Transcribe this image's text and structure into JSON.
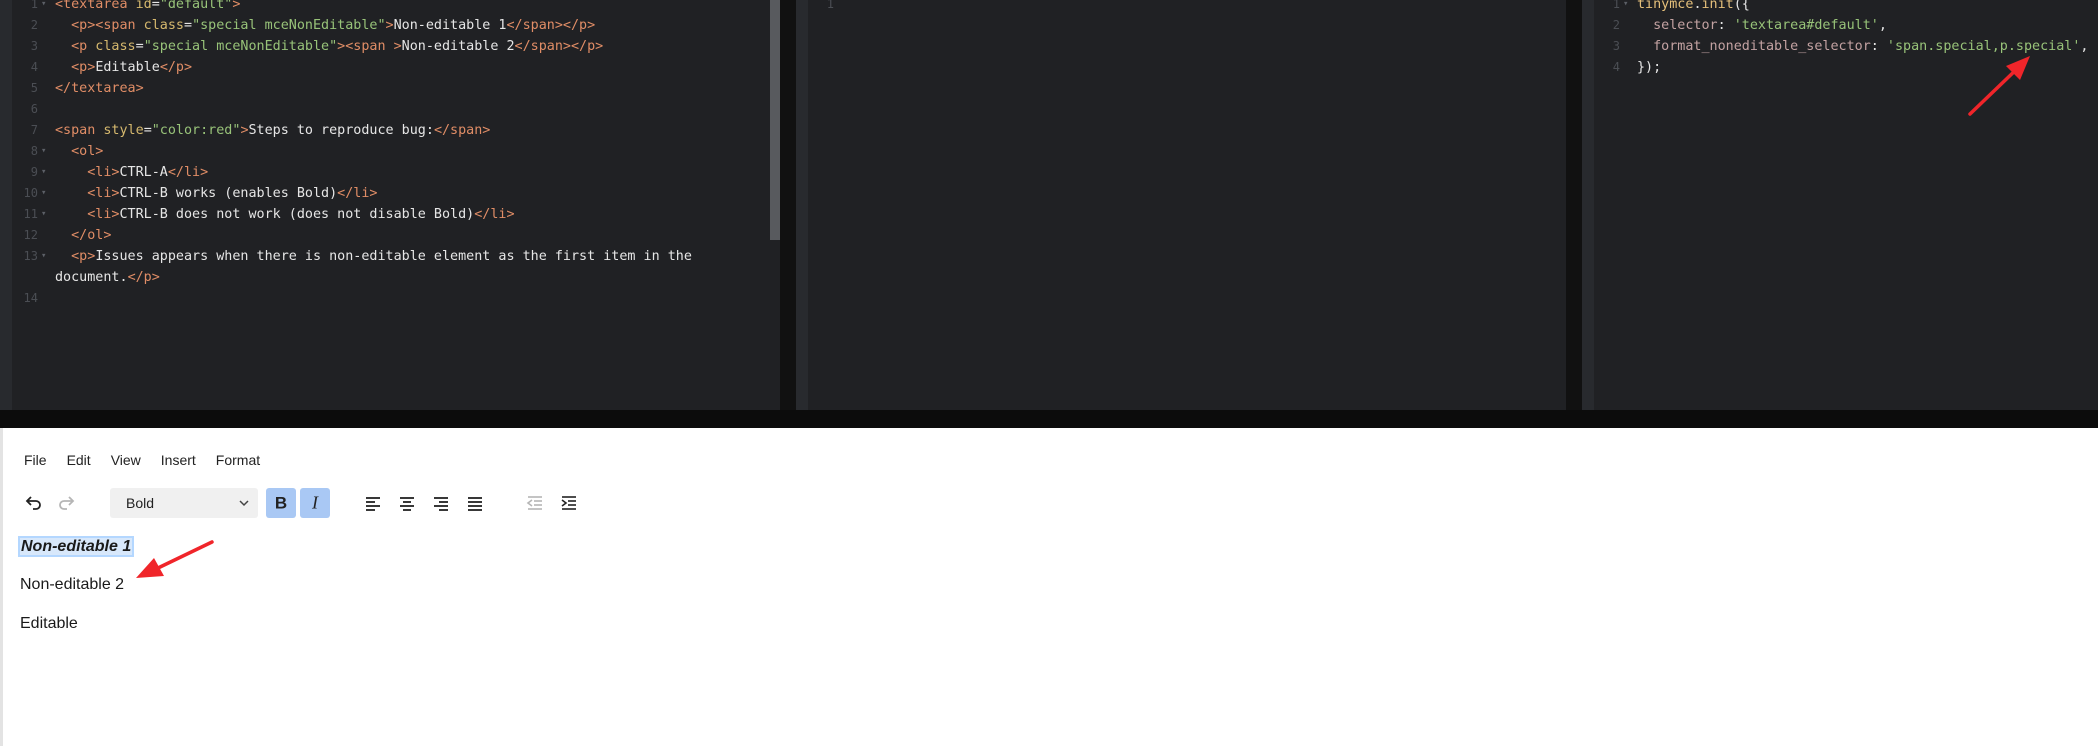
{
  "html_pane": {
    "lines": [
      {
        "n": "1",
        "fold": true,
        "segs": [
          [
            "t",
            "<textarea"
          ],
          [
            "a",
            " id"
          ],
          [
            "p",
            "="
          ],
          [
            "s",
            "\"default\""
          ],
          [
            "t",
            ">"
          ]
        ]
      },
      {
        "n": "2",
        "fold": false,
        "segs": [
          [
            "p",
            "  "
          ],
          [
            "t",
            "<p><span"
          ],
          [
            "a",
            " class"
          ],
          [
            "p",
            "="
          ],
          [
            "s",
            "\"special mceNonEditable\""
          ],
          [
            "t",
            ">"
          ],
          [
            "k",
            "Non-editable 1"
          ],
          [
            "t",
            "</span></p>"
          ]
        ]
      },
      {
        "n": "3",
        "fold": false,
        "segs": [
          [
            "p",
            "  "
          ],
          [
            "t",
            "<p"
          ],
          [
            "a",
            " class"
          ],
          [
            "p",
            "="
          ],
          [
            "s",
            "\"special mceNonEditable\""
          ],
          [
            "t",
            "><span >"
          ],
          [
            "k",
            "Non-editable 2"
          ],
          [
            "t",
            "</span></p>"
          ]
        ]
      },
      {
        "n": "4",
        "fold": false,
        "segs": [
          [
            "p",
            "  "
          ],
          [
            "t",
            "<p>"
          ],
          [
            "k",
            "Editable"
          ],
          [
            "t",
            "</p>"
          ]
        ]
      },
      {
        "n": "5",
        "fold": false,
        "segs": [
          [
            "t",
            "</textarea>"
          ]
        ]
      },
      {
        "n": "6",
        "fold": false,
        "segs": []
      },
      {
        "n": "7",
        "fold": false,
        "segs": [
          [
            "t",
            "<span"
          ],
          [
            "a",
            " style"
          ],
          [
            "p",
            "="
          ],
          [
            "s",
            "\"color:red\""
          ],
          [
            "t",
            ">"
          ],
          [
            "k",
            "Steps to reproduce bug:"
          ],
          [
            "t",
            "</span>"
          ]
        ]
      },
      {
        "n": "8",
        "fold": true,
        "segs": [
          [
            "p",
            "  "
          ],
          [
            "t",
            "<ol>"
          ]
        ]
      },
      {
        "n": "9",
        "fold": true,
        "segs": [
          [
            "p",
            "    "
          ],
          [
            "t",
            "<li>"
          ],
          [
            "k",
            "CTRL-A"
          ],
          [
            "t",
            "</li>"
          ]
        ]
      },
      {
        "n": "10",
        "fold": true,
        "segs": [
          [
            "p",
            "    "
          ],
          [
            "t",
            "<li>"
          ],
          [
            "k",
            "CTRL-B works (enables Bold)"
          ],
          [
            "t",
            "</li>"
          ]
        ]
      },
      {
        "n": "11",
        "fold": true,
        "segs": [
          [
            "p",
            "    "
          ],
          [
            "t",
            "<li>"
          ],
          [
            "k",
            "CTRL-B does not work (does not disable Bold)"
          ],
          [
            "t",
            "</li>"
          ]
        ]
      },
      {
        "n": "12",
        "fold": false,
        "segs": [
          [
            "p",
            "  "
          ],
          [
            "t",
            "</ol>"
          ]
        ]
      },
      {
        "n": "13",
        "fold": true,
        "segs": [
          [
            "p",
            "  "
          ],
          [
            "t",
            "<p>"
          ],
          [
            "k",
            "Issues appears when there is non-editable element as the first item in the"
          ]
        ]
      },
      {
        "n": "",
        "fold": false,
        "segs": [
          [
            "k",
            "document."
          ],
          [
            "t",
            "</p>"
          ]
        ]
      },
      {
        "n": "14",
        "fold": false,
        "segs": []
      }
    ]
  },
  "css_pane": {
    "lines": [
      {
        "n": "1",
        "fold": false,
        "segs": []
      }
    ]
  },
  "js_pane": {
    "lines": [
      {
        "n": "1",
        "fold": true,
        "segs": [
          [
            "f",
            "tinymce"
          ],
          [
            "p",
            "."
          ],
          [
            "f",
            "init"
          ],
          [
            "p",
            "({"
          ]
        ]
      },
      {
        "n": "2",
        "fold": false,
        "segs": [
          [
            "p",
            "  "
          ],
          [
            "pr",
            "selector"
          ],
          [
            "p",
            ": "
          ],
          [
            "s",
            "'textarea#default'"
          ],
          [
            "p",
            ","
          ]
        ]
      },
      {
        "n": "3",
        "fold": false,
        "segs": [
          [
            "p",
            "  "
          ],
          [
            "pr",
            "format_noneditable_selector"
          ],
          [
            "p",
            ": "
          ],
          [
            "s",
            "'span.special,p.special'"
          ],
          [
            "p",
            ","
          ]
        ]
      },
      {
        "n": "4",
        "fold": false,
        "segs": [
          [
            "p",
            "});"
          ]
        ]
      }
    ]
  },
  "editor": {
    "menu": [
      "File",
      "Edit",
      "View",
      "Insert",
      "Format"
    ],
    "block_format": "Bold",
    "paragraphs": {
      "p1": "Non-editable 1",
      "p2": "Non-editable 2",
      "p3": "Editable"
    }
  },
  "colors": {
    "code_bg": "#202124",
    "tag": "#e08d66",
    "attr": "#d6b96e",
    "string": "#98c379",
    "active_button": "#a9c8f4",
    "annotation_arrow": "#f0252a"
  }
}
